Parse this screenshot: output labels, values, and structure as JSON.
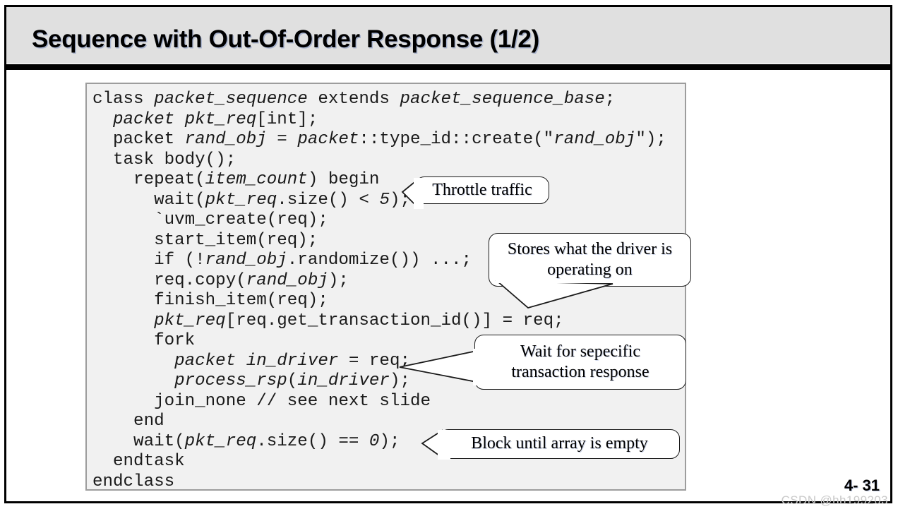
{
  "slide": {
    "title": "Sequence with Out-Of-Order Response (1/2)",
    "page_number": "4- 31",
    "watermark": "CSDN @hh199203",
    "colors": {
      "title_band": "#e0e0e0",
      "rule": "#000000",
      "code_background": "#f1f1f1",
      "code_border": "#9d9d9d",
      "callout_background": "#ffffff",
      "callout_border": "#1a1a1a",
      "watermark_text": "#c9c9c9"
    }
  },
  "code": {
    "language": "systemverilog-uvm",
    "lines": [
      "class <i>packet_sequence</i> extends <i>packet_sequence_base</i>;",
      "  <i>packet pkt_req</i>[int];",
      "  packet <i>rand_obj</i> = <i>packet</i>::type_id::create(\"<i>rand_obj</i>\");",
      "  task body();",
      "    repeat(<i>item_count</i>) begin",
      "      wait(<i>pkt_req</i>.size() &lt; <i>5</i>);",
      "      `uvm_create(req);",
      "      start_item(req);",
      "      if (!<i>rand_obj</i>.randomize()) ...;",
      "      req.copy(<i>rand_obj</i>);",
      "      finish_item(req);",
      "      <i>pkt_req</i>[req.get_transaction_id()] = req;",
      "      fork",
      "        <i>packet in_driver</i> = req;",
      "        <i>process_rsp</i>(<i>in_driver</i>);",
      "      join_none // see next slide",
      "    end",
      "    wait(<i>pkt_req</i>.size() == <i>0</i>);",
      "  endtask",
      "endclass"
    ],
    "plain_text": [
      "class packet_sequence extends packet_sequence_base;",
      "  packet pkt_req[int];",
      "  packet rand_obj = packet::type_id::create(\"rand_obj\");",
      "  task body();",
      "    repeat(item_count) begin",
      "      wait(pkt_req.size() < 5);",
      "      `uvm_create(req);",
      "      start_item(req);",
      "      if (!rand_obj.randomize()) ...;",
      "      req.copy(rand_obj);",
      "      finish_item(req);",
      "      pkt_req[req.get_transaction_id()] = req;",
      "      fork",
      "        packet in_driver = req;",
      "        process_rsp(in_driver);",
      "      join_none // see next slide",
      "    end",
      "    wait(pkt_req.size() == 0);",
      "  endtask",
      "endclass"
    ]
  },
  "callouts": [
    {
      "id": "throttle",
      "text": "Throttle traffic",
      "points_to": "wait(pkt_req.size() < 5);"
    },
    {
      "id": "stores",
      "text": "Stores what the driver is operating on",
      "points_to": "pkt_req[req.get_transaction_id()] = req;"
    },
    {
      "id": "wait",
      "text": "Wait for sepecific transaction response",
      "points_to": "process_rsp(in_driver);"
    },
    {
      "id": "block",
      "text": "Block until array is empty",
      "points_to": "wait(pkt_req.size() == 0);"
    }
  ]
}
